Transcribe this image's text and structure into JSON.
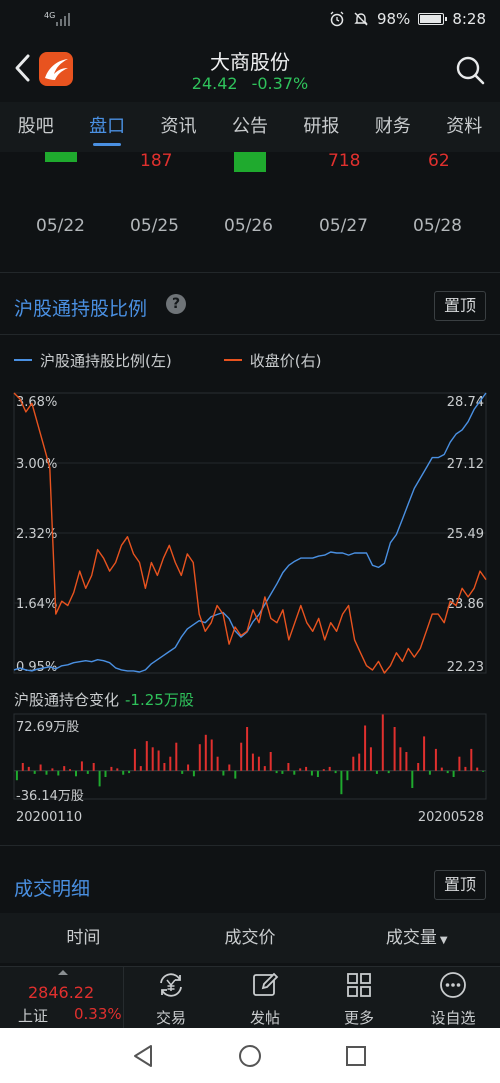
{
  "status_bar": {
    "network": "4G",
    "battery": "98%",
    "time": "8:28"
  },
  "header": {
    "title": "大商股份",
    "price": "24.42",
    "change_pct": "-0.37%",
    "back_icon": "chevron-left-icon",
    "search_icon": "search-icon"
  },
  "tabs": [
    "股吧",
    "盘口",
    "资讯",
    "公告",
    "研报",
    "财务",
    "资料"
  ],
  "active_tab": "盘口",
  "prev_section": {
    "values": [
      "187",
      "718",
      "62"
    ],
    "dates": [
      "05/22",
      "05/25",
      "05/26",
      "05/27",
      "05/28"
    ]
  },
  "hk_holding": {
    "title": "沪股通持股比例",
    "help_icon": "question-icon",
    "pin_label": "置顶",
    "legend": [
      {
        "name": "沪股通持股比例(左)",
        "color": "#4a90e2"
      },
      {
        "name": "收盘价(右)",
        "color": "#e8531f"
      }
    ]
  },
  "chart_data": [
    {
      "type": "line",
      "left_axis_ticks": [
        "3.68%",
        "3.00%",
        "2.32%",
        "1.64%",
        "0.95%"
      ],
      "right_axis_ticks": [
        "28.74",
        "27.12",
        "25.49",
        "23.86",
        "22.23"
      ],
      "ylim_left": [
        0.95,
        3.68
      ],
      "ylim_right": [
        22.23,
        28.74
      ],
      "grid": true,
      "series": [
        {
          "name": "沪股通持股比例(左)",
          "axis": "left",
          "color": "#4a90e2",
          "values": [
            0.98,
            1.0,
            0.98,
            0.97,
            0.99,
            1.0,
            1.01,
            0.99,
            1.02,
            1.03,
            1.05,
            1.06,
            1.07,
            1.06,
            1.08,
            1.07,
            1.05,
            1.0,
            0.98,
            0.97,
            0.97,
            0.96,
            0.98,
            1.04,
            1.08,
            1.12,
            1.16,
            1.2,
            1.3,
            1.38,
            1.42,
            1.46,
            1.44,
            1.5,
            1.52,
            1.54,
            1.48,
            1.36,
            1.3,
            1.35,
            1.45,
            1.52,
            1.62,
            1.72,
            1.82,
            1.93,
            2.0,
            2.04,
            2.07,
            2.07,
            2.07,
            2.09,
            2.1,
            2.13,
            2.12,
            2.12,
            2.1,
            2.12,
            2.12,
            2.12,
            2.0,
            1.98,
            2.02,
            2.22,
            2.3,
            2.45,
            2.6,
            2.75,
            2.85,
            2.95,
            3.05,
            3.05,
            3.08,
            3.2,
            3.28,
            3.32,
            3.4,
            3.52,
            3.6,
            3.68
          ]
        },
        {
          "name": "收盘价(右)",
          "axis": "right",
          "color": "#e8531f",
          "values": [
            28.74,
            28.6,
            28.3,
            28.5,
            28.0,
            27.5,
            27.0,
            23.6,
            23.9,
            23.8,
            24.1,
            24.6,
            24.2,
            24.5,
            25.1,
            24.9,
            24.6,
            24.8,
            25.2,
            25.4,
            25.0,
            24.8,
            24.2,
            24.8,
            24.5,
            24.9,
            25.2,
            24.8,
            24.5,
            25.0,
            24.8,
            23.6,
            23.2,
            23.4,
            23.8,
            23.6,
            22.9,
            23.3,
            23.1,
            23.2,
            23.7,
            23.4,
            24.0,
            23.5,
            23.4,
            23.7,
            23.0,
            23.4,
            23.8,
            23.4,
            23.2,
            23.5,
            23.0,
            23.4,
            23.2,
            23.6,
            23.8,
            23.0,
            22.7,
            22.4,
            22.3,
            22.5,
            22.23,
            22.4,
            22.7,
            22.5,
            22.8,
            22.6,
            22.8,
            23.2,
            23.6,
            23.6,
            23.4,
            23.9,
            23.8,
            24.2,
            24.0,
            24.2,
            24.6,
            24.4
          ]
        }
      ]
    },
    {
      "type": "bar",
      "title": "沪股通持仓变化",
      "latest_change": "-1.25万股",
      "max_label": "72.69万股",
      "min_label": "-36.14万股",
      "x_start": "20200110",
      "x_end": "20200528",
      "ylim": [
        -36.14,
        72.69
      ],
      "unit": "万股",
      "values": [
        -12,
        10,
        5,
        -4,
        8,
        -5,
        3,
        -6,
        6,
        2,
        -7,
        12,
        -4,
        10,
        -20,
        -8,
        5,
        3,
        -5,
        -3,
        28,
        6,
        38,
        30,
        26,
        10,
        18,
        36,
        -4,
        8,
        -7,
        34,
        46,
        40,
        18,
        -6,
        8,
        -10,
        36,
        56,
        22,
        18,
        6,
        24,
        -3,
        -4,
        10,
        -5,
        3,
        5,
        -6,
        -8,
        2,
        5,
        -3,
        -30,
        -12,
        18,
        22,
        58,
        30,
        -4,
        72,
        -3,
        56,
        30,
        24,
        -22,
        10,
        44,
        -5,
        28,
        4,
        -3,
        -8,
        18,
        5,
        28,
        4,
        -1.25
      ]
    }
  ],
  "trade_detail": {
    "title": "成交明细",
    "pin_label": "置顶",
    "columns": [
      "时间",
      "成交价",
      "成交量"
    ],
    "sort_icon": "caret-down-icon"
  },
  "bottom_bar": {
    "index_value": "2846.22",
    "index_name": "上证",
    "index_pct": "0.33%",
    "items": [
      {
        "label": "交易",
        "icon": "yuan-refresh-icon"
      },
      {
        "label": "发帖",
        "icon": "edit-icon"
      },
      {
        "label": "更多",
        "icon": "grid-icon"
      },
      {
        "label": "设自选",
        "icon": "more-circle-icon"
      }
    ]
  },
  "system_nav": [
    "back-triangle-icon",
    "home-circle-icon",
    "recents-square-icon"
  ]
}
